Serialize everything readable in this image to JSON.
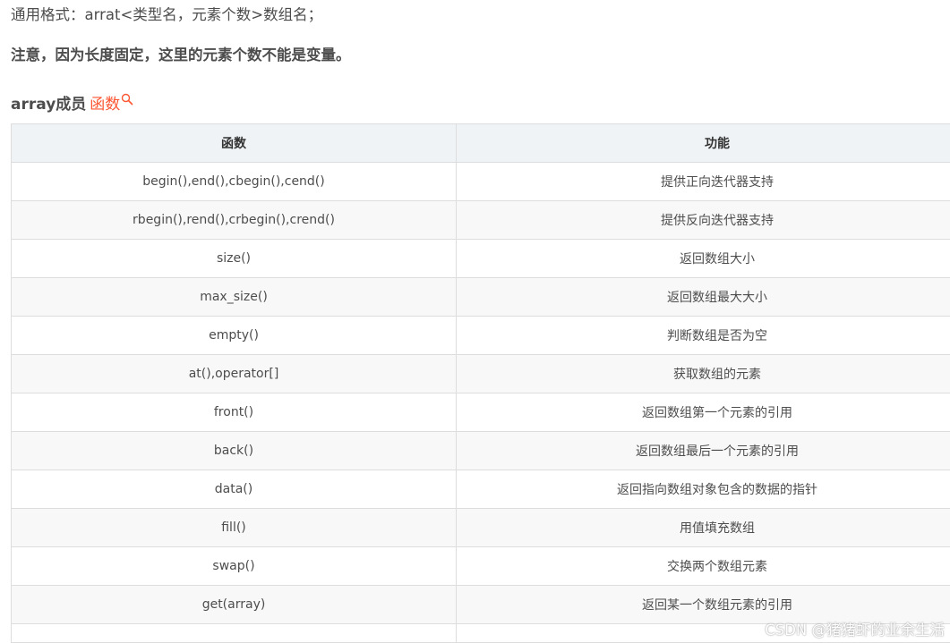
{
  "intro": {
    "format_line": "通用格式：arrat<类型名，元素个数>数组名；",
    "note_line": "注意，因为长度固定，这里的元素个数不能是变量。"
  },
  "section": {
    "heading_bold": "array成员",
    "heading_link": "函数",
    "link_color": "#fc5531",
    "link_icon": "search-icon"
  },
  "table": {
    "headers": [
      "函数",
      "功能"
    ],
    "rows": [
      [
        "begin(),end(),cbegin(),cend()",
        "提供正向迭代器支持"
      ],
      [
        "rbegin(),rend(),crbegin(),crend()",
        "提供反向迭代器支持"
      ],
      [
        "size()",
        "返回数组大小"
      ],
      [
        "max_size()",
        "返回数组最大大小"
      ],
      [
        "empty()",
        "判断数组是否为空"
      ],
      [
        "at(),operator[]",
        "获取数组的元素"
      ],
      [
        "front()",
        "返回数组第一个元素的引用"
      ],
      [
        "back()",
        "返回数组最后一个元素的引用"
      ],
      [
        "data()",
        "返回指向数组对象包含的数据的指针"
      ],
      [
        "fill()",
        "用值填充数组"
      ],
      [
        "swap()",
        "交换两个数组元素"
      ],
      [
        "get(array)",
        "返回某一个数组元素的引用"
      ]
    ]
  },
  "watermark": "CSDN @猪猪虾的业余生活"
}
